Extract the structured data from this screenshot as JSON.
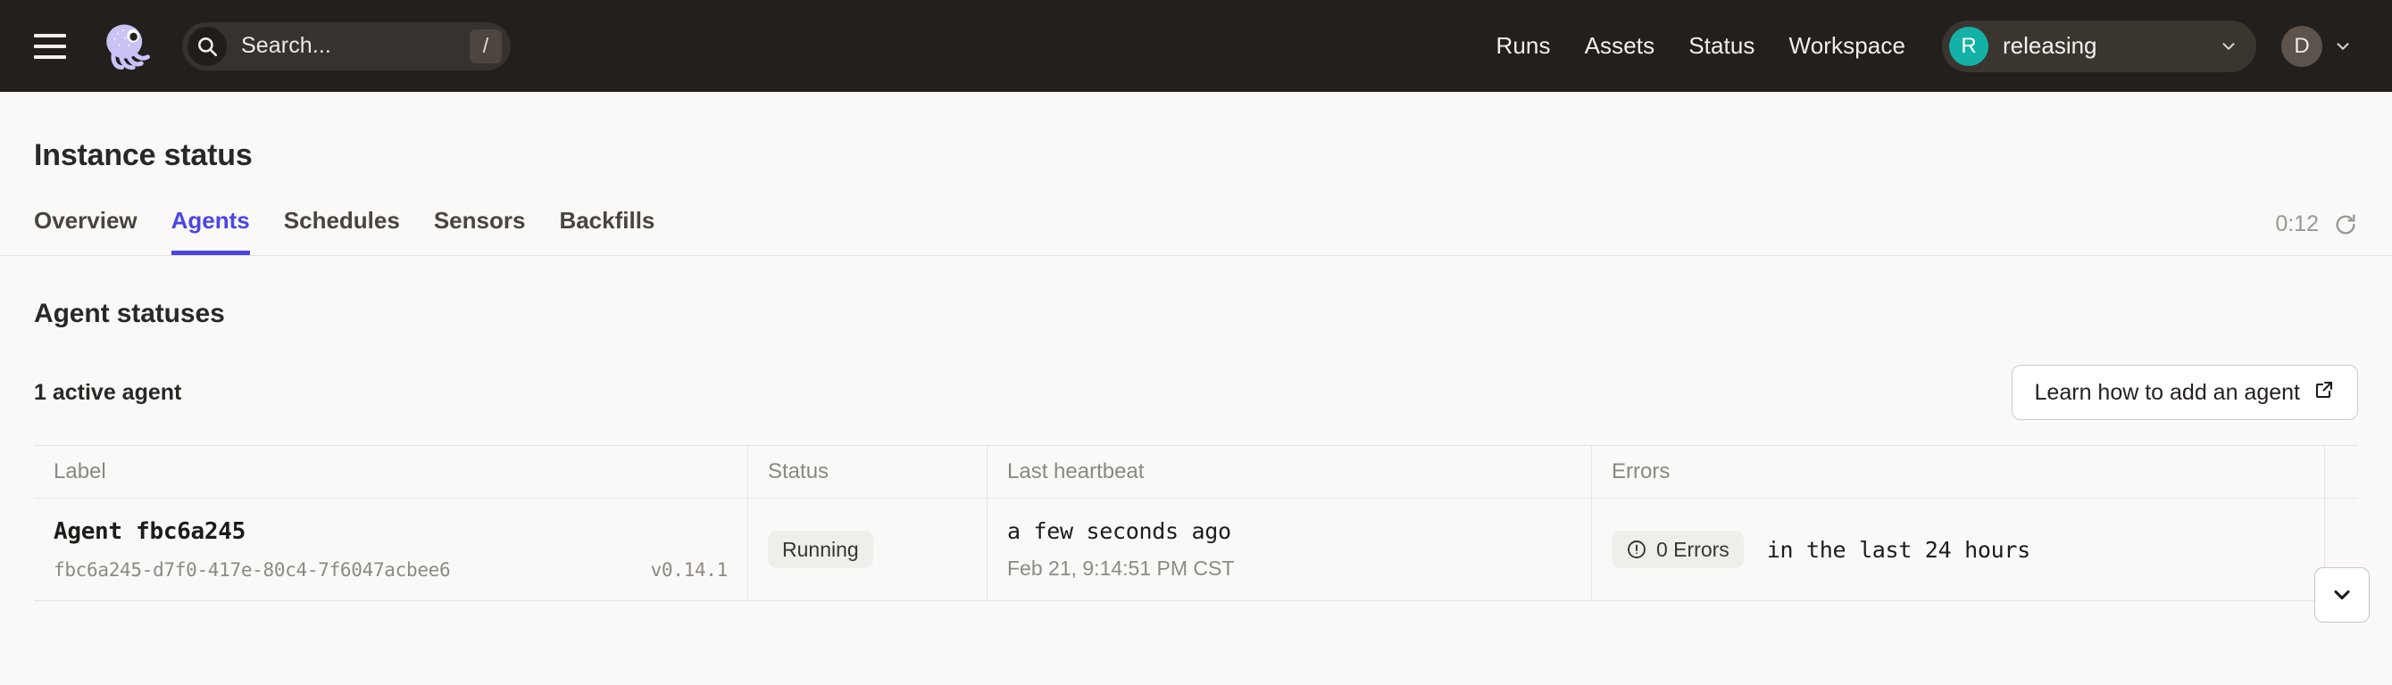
{
  "header": {
    "menu_icon": "hamburger-menu-icon",
    "logo_icon": "dagster-logo-icon",
    "search": {
      "icon": "search-icon",
      "placeholder": "Search...",
      "value": "",
      "shortcut": "/"
    },
    "nav": [
      {
        "label": "Runs"
      },
      {
        "label": "Assets"
      },
      {
        "label": "Status"
      },
      {
        "label": "Workspace"
      }
    ],
    "organization": {
      "avatar_initial": "R",
      "avatar_color": "#14B2A6",
      "name": "releasing",
      "chevron_icon": "chevron-down-icon"
    },
    "user": {
      "avatar_initial": "D",
      "chevron_icon": "chevron-down-icon"
    },
    "background_color": "#231F1C"
  },
  "page": {
    "title": "Instance status",
    "tabs": [
      {
        "label": "Overview",
        "active": false
      },
      {
        "label": "Agents",
        "active": true
      },
      {
        "label": "Schedules",
        "active": false
      },
      {
        "label": "Sensors",
        "active": false
      },
      {
        "label": "Backfills",
        "active": false
      }
    ],
    "active_tab_color": "#4B45E5",
    "refresh": {
      "countdown": "0:12",
      "icon": "refresh-icon"
    }
  },
  "main": {
    "section_title": "Agent statuses",
    "active_count": "1 active agent",
    "learn_button": {
      "label": "Learn how to add an agent",
      "icon": "external-link-icon"
    },
    "table": {
      "columns": [
        "Label",
        "Status",
        "Last heartbeat",
        "Errors"
      ],
      "rows": [
        {
          "label": {
            "name": "Agent fbc6a245",
            "uuid": "fbc6a245-d7f0-417e-80c4-7f6047acbee6",
            "version": "v0.14.1"
          },
          "status": "Running",
          "heartbeat": {
            "relative": "a few seconds ago",
            "absolute": "Feb 21, 9:14:51 PM CST"
          },
          "errors": {
            "badge": "0 Errors",
            "badge_icon": "alert-circle-icon",
            "note": "in the last 24 hours"
          },
          "expand_icon": "chevron-down-icon"
        }
      ]
    }
  }
}
